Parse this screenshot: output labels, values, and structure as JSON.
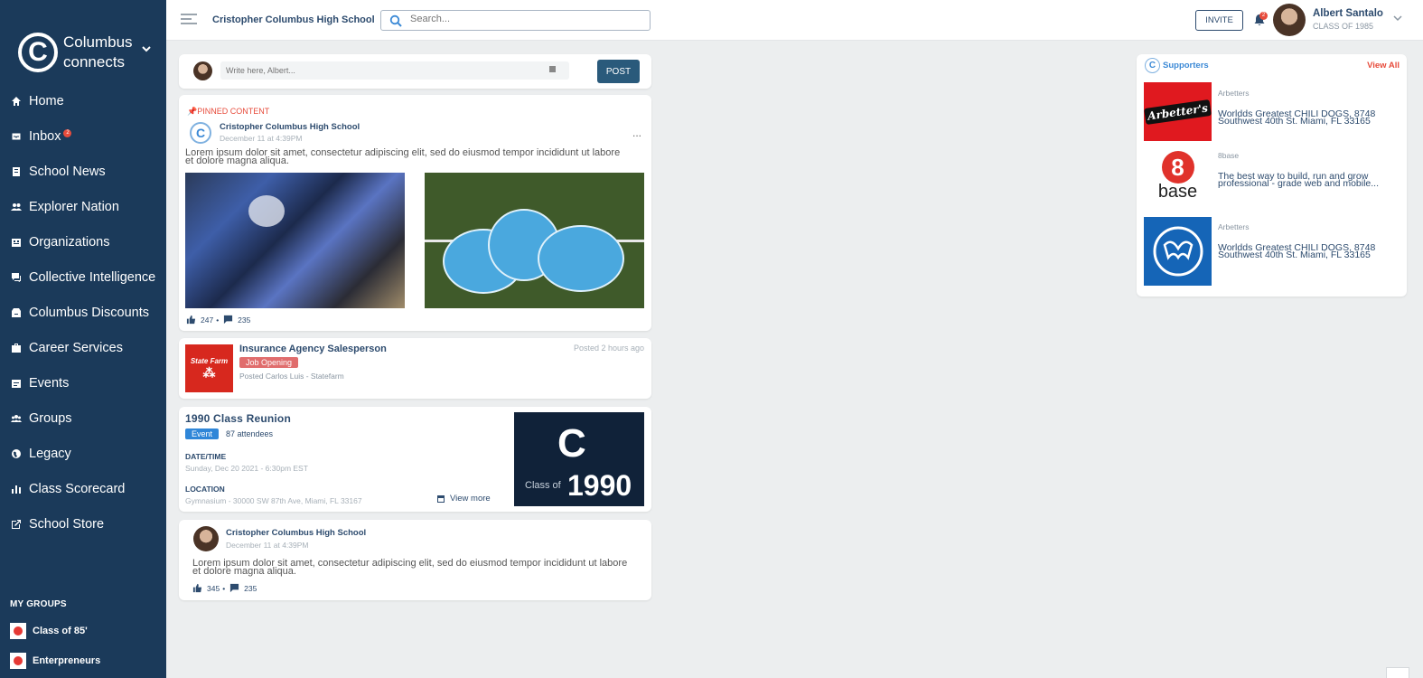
{
  "brand": {
    "logo_letter": "C",
    "name_line1": "Columbus",
    "name_line2": "connects",
    "chevron": "⌄"
  },
  "sidebar": {
    "items": [
      {
        "label": "Home",
        "icon": "home-icon"
      },
      {
        "label": "Inbox",
        "icon": "inbox-icon",
        "badge": "2"
      },
      {
        "label": "School News",
        "icon": "news-icon"
      },
      {
        "label": "Explorer Nation",
        "icon": "people-icon"
      },
      {
        "label": "Organizations",
        "icon": "building-icon"
      },
      {
        "label": "Collective Intelligence",
        "icon": "chat-icon"
      },
      {
        "label": "Columbus Discounts",
        "icon": "store-icon"
      },
      {
        "label": "Career Services",
        "icon": "briefcase-icon"
      },
      {
        "label": "Events",
        "icon": "calendar-icon"
      },
      {
        "label": "Groups",
        "icon": "groups-icon"
      },
      {
        "label": "Legacy",
        "icon": "globe-icon"
      },
      {
        "label": "Class Scorecard",
        "icon": "bar-chart-icon"
      },
      {
        "label": "School Store",
        "icon": "external-link-icon"
      }
    ],
    "my_groups_title": "MY GROUPS",
    "groups": [
      {
        "label": "Class of 85'"
      },
      {
        "label": "Enterpreneurs"
      }
    ]
  },
  "header": {
    "school_name": "Cristopher Columbus High School",
    "search_placeholder": "Search...",
    "invite_label": "INVITE",
    "notification_count": "2",
    "user_name": "Albert Santalo",
    "user_class": "CLASS OF 1985"
  },
  "composer": {
    "placeholder": "Write here, Albert...",
    "post_label": "POST"
  },
  "pinned_post": {
    "pinned_label": "PINNED CONTENT",
    "author": "Cristopher Columbus High School",
    "date": "December 11 at 4:39PM",
    "body_line1": "Lorem ipsum dolor sit amet, consectetur adipiscing elit, sed do eiusmod tempor incididunt ut labore",
    "body_line2": "et dolore magna aliqua.",
    "more": "...",
    "likes": "247",
    "comments": "235"
  },
  "job_post": {
    "logo_text": "State Farm",
    "title": "Insurance Agency Salesperson",
    "badge": "Job Opening",
    "posted_by": "Posted Carlos Luis - Statefarm",
    "time": "Posted 2 hours ago"
  },
  "event_post": {
    "title": "1990 Class Reunion",
    "badge": "Event",
    "attendees": "87 attendees",
    "datetime_label": "DATE/TIME",
    "datetime_value": "Sunday, Dec 20 2021 - 6:30pm EST",
    "location_label": "LOCATION",
    "location_value": "Gymnasium - 30000 SW 87th Ave, Miami, FL 33167",
    "view_more": "View more",
    "image_class_of": "Class of",
    "image_year": "1990"
  },
  "second_post": {
    "author": "Cristopher Columbus High School",
    "date": "December 11 at 4:39PM",
    "body_line1": "Lorem ipsum dolor sit amet, consectetur adipiscing elit, sed do eiusmod tempor incididunt ut labore",
    "body_line2": "et dolore magna aliqua.",
    "likes": "345",
    "comments": "235"
  },
  "supporters": {
    "title": "Supporters",
    "view_all": "View All",
    "items": [
      {
        "name": "Arbetters",
        "logo_text": "Arbetter's",
        "desc_line1": "Worldds Greatest CHILI DOGS, 8748",
        "desc_line2": "Southwest 40th St. Miami, FL 33165"
      },
      {
        "name": "8base",
        "logo_text": "base",
        "logo_digit": "8",
        "desc_line1": "The best way to build, run and grow",
        "desc_line2": "professional - grade web and mobile..."
      },
      {
        "name": "Arbetters",
        "desc_line1": "Worldds Greatest CHILI DOGS, 8748",
        "desc_line2": "Southwest 40th St. Miami, FL 33165"
      }
    ]
  },
  "colors": {
    "sidebar_bg": "#1b3a5a",
    "accent": "#2d4b6e",
    "link_blue": "#3b89d6",
    "alert_red": "#e74c3c",
    "post_button": "#2a5a7b"
  }
}
